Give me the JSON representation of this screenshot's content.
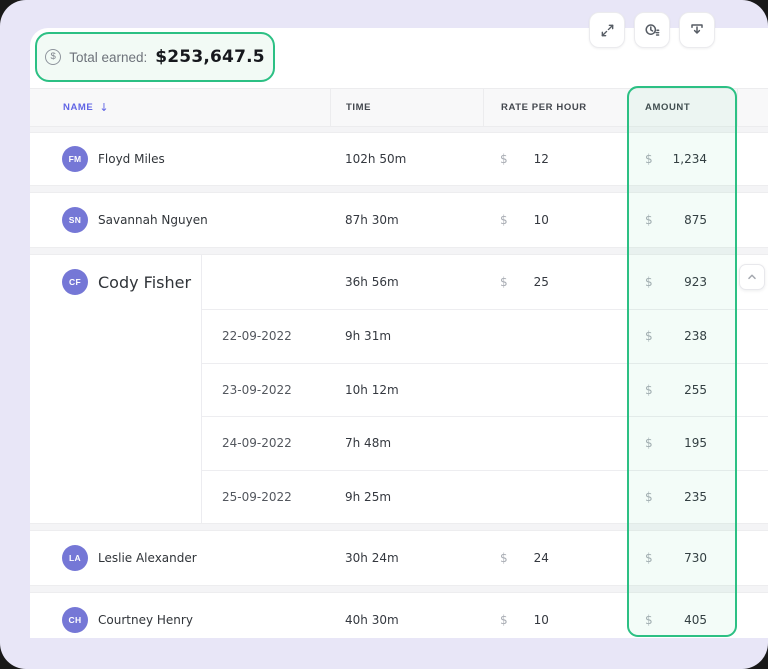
{
  "summary": {
    "icon_symbol": "$",
    "label": "Total earned:",
    "value": "$253,647.5"
  },
  "toolbar": {
    "buttons": [
      {
        "name": "expand"
      },
      {
        "name": "time-report"
      },
      {
        "name": "download"
      }
    ]
  },
  "table": {
    "currency": "$",
    "sort_arrow": "↓",
    "columns": [
      {
        "label": "NAME",
        "sorted": "desc"
      },
      {
        "label": "TIME"
      },
      {
        "label": "RATE PER HOUR"
      },
      {
        "label": "AMOUNT",
        "highlighted": true
      }
    ],
    "rows": [
      {
        "type": "person",
        "initials": "FM",
        "name": "Floyd Miles",
        "time": "102h 50m",
        "rate": "12",
        "amount": "1,234"
      },
      {
        "type": "person",
        "initials": "SN",
        "name": "Savannah Nguyen",
        "time": "87h 30m",
        "rate": "10",
        "amount": "875"
      },
      {
        "type": "group",
        "initials": "CF",
        "name": "Cody Fisher",
        "time": "36h 56m",
        "rate": "25",
        "amount": "923",
        "expanded": true,
        "details": [
          {
            "date": "22-09-2022",
            "time": "9h 31m",
            "amount": "238"
          },
          {
            "date": "23-09-2022",
            "time": "10h 12m",
            "amount": "255"
          },
          {
            "date": "24-09-2022",
            "time": "7h 48m",
            "amount": "195"
          },
          {
            "date": "25-09-2022",
            "time": "9h 25m",
            "amount": "235"
          }
        ]
      },
      {
        "type": "person",
        "initials": "LA",
        "name": "Leslie Alexander",
        "time": "30h 24m",
        "rate": "24",
        "amount": "730"
      },
      {
        "type": "person",
        "initials": "CH",
        "name": "Courtney Henry",
        "time": "40h 30m",
        "rate": "10",
        "amount": "405"
      }
    ]
  },
  "colors": {
    "accent_green": "#2cc084",
    "accent_indigo": "#6165e5",
    "avatar_purple": "#7577d6",
    "page_background": "#e8e6f7"
  }
}
